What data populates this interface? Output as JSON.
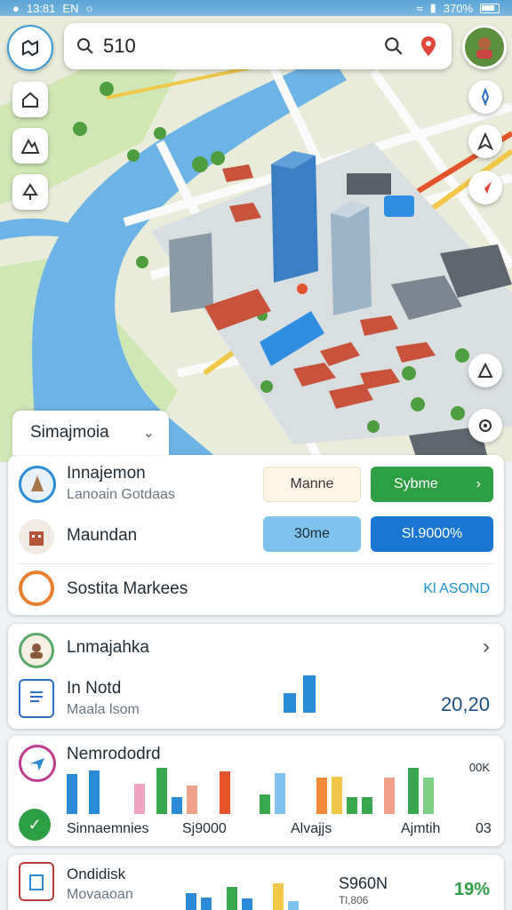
{
  "status": {
    "time": "13:81",
    "carrier": "EN",
    "battery": "370%"
  },
  "search": {
    "query": "510"
  },
  "dropdown": {
    "label": "Simajmoia"
  },
  "card1": {
    "row1": {
      "title": "Innajemon",
      "subtitle": "Lanoain Gotdaas",
      "pill_left": "Manne",
      "pill_right": "Sybme"
    },
    "row2": {
      "title": "Maundan",
      "pill_left": "30me",
      "pill_right": "Sl.9000%"
    },
    "row3": {
      "title": "Sostita Markees",
      "value": "Kl ASOND"
    }
  },
  "card2": {
    "row1": {
      "title": "Lnmajahka"
    },
    "row2": {
      "title": "In Notd",
      "subtitle": "Maala lsom",
      "value": "20,20"
    }
  },
  "card3": {
    "title": "Nemrododrd",
    "top_right": "00K",
    "labels": [
      "Sinnaemnies",
      "Sj9000",
      "Alvajjs",
      "Ajmtih",
      "03"
    ]
  },
  "card4": {
    "title": "Ondidisk",
    "subtitle": "Movaaoan",
    "value": "S960N",
    "value_sub": "Tl,806",
    "percent": "19%"
  },
  "colors": {
    "accent": "#1976d2",
    "green": "#2e9e44",
    "blue_light": "#7ec3ee",
    "orange": "#e8802f",
    "map_water": "#6db4e6"
  }
}
